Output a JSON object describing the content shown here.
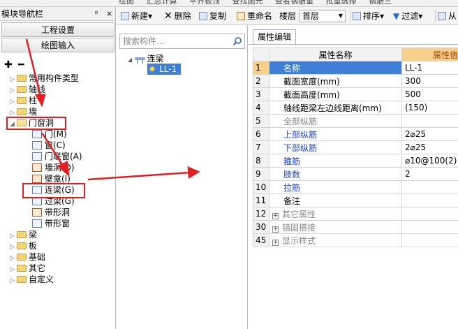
{
  "topbar": {
    "items": [
      "绘图",
      "汇总计算",
      "平齐板顶",
      "查找图元",
      "查看钢筋量",
      "批量选择",
      "钢筋三"
    ]
  },
  "nav": {
    "title": "模块导航栏",
    "pin": "ᵖ",
    "close": "×",
    "project_settings": "工程设置",
    "drawing_input": "绘图输入",
    "expand_all": "✚",
    "collapse_all": "━",
    "tree": [
      {
        "label": "常用构件类型",
        "expand": "▷"
      },
      {
        "label": "轴线",
        "expand": "▷"
      },
      {
        "label": "柱",
        "expand": "▷"
      },
      {
        "label": "墙",
        "expand": "▷"
      },
      {
        "label": "门窗洞",
        "expand": "◢"
      },
      {
        "label": "门(M)"
      },
      {
        "label": "窗(C)"
      },
      {
        "label": "门联窗(A)"
      },
      {
        "label": "墙洞(D)"
      },
      {
        "label": "壁龛(I)"
      },
      {
        "label": "连梁(G)"
      },
      {
        "label": "过梁(G)"
      },
      {
        "label": "带形洞"
      },
      {
        "label": "带形窗"
      },
      {
        "label": "梁",
        "expand": "▷"
      },
      {
        "label": "板",
        "expand": "▷"
      },
      {
        "label": "基础",
        "expand": "▷"
      },
      {
        "label": "其它",
        "expand": "▷"
      },
      {
        "label": "自定义",
        "expand": "▷"
      }
    ]
  },
  "toolbar": {
    "new": "新建",
    "delete": "删除",
    "copy": "复制",
    "rename": "重命名",
    "floor_label": "楼层",
    "floor_value": "首层",
    "sort": "排序",
    "filter": "过滤",
    "more": "从"
  },
  "components": {
    "search_placeholder": "搜索构件...",
    "root": "连梁",
    "child": "LL-1"
  },
  "props": {
    "tab": "属性编辑",
    "col_name": "属性名称",
    "col_value": "属性值",
    "rows": [
      {
        "num": "1",
        "name": "名称",
        "value": "LL-1"
      },
      {
        "num": "2",
        "name": "截面宽度(mm)",
        "value": "300"
      },
      {
        "num": "3",
        "name": "截面高度(mm)",
        "value": "500"
      },
      {
        "num": "4",
        "name": "轴线距梁左边线距离(mm)",
        "value": "(150)"
      },
      {
        "num": "5",
        "name": "全部纵筋",
        "value": ""
      },
      {
        "num": "6",
        "name": "上部纵筋",
        "value": "2⌀25"
      },
      {
        "num": "7",
        "name": "下部纵筋",
        "value": "2⌀25"
      },
      {
        "num": "8",
        "name": "箍筋",
        "value": "⌀10@100(2)"
      },
      {
        "num": "9",
        "name": "肢数",
        "value": "2"
      },
      {
        "num": "10",
        "name": "拉筋",
        "value": ""
      },
      {
        "num": "11",
        "name": "备注",
        "value": ""
      },
      {
        "num": "12",
        "name": "其它属性",
        "value": ""
      },
      {
        "num": "30",
        "name": "锚固搭接",
        "value": ""
      },
      {
        "num": "45",
        "name": "显示样式",
        "value": ""
      }
    ]
  },
  "colors": {
    "annotation_red": "#e02020",
    "selected_blue": "#3f7fd8",
    "header_orange": "#f8d08a",
    "link_blue": "#1a3fd1"
  }
}
